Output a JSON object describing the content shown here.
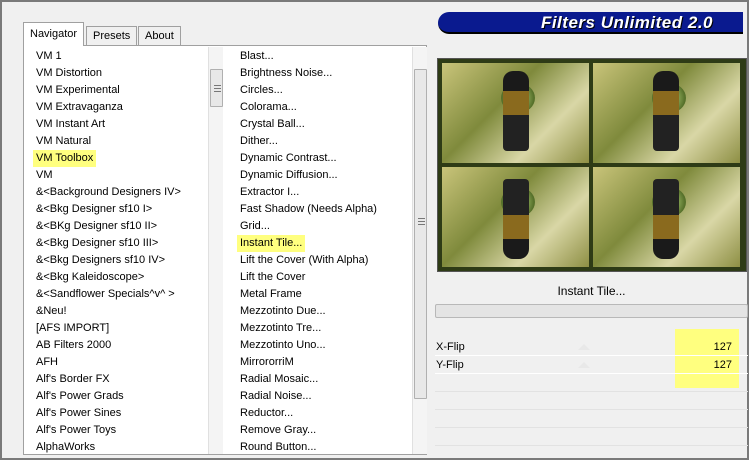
{
  "app": {
    "title": "Filters Unlimited 2.0"
  },
  "tabs": [
    {
      "label": "Navigator",
      "active": true
    },
    {
      "label": "Presets",
      "active": false
    },
    {
      "label": "About",
      "active": false
    }
  ],
  "categories": {
    "items": [
      "VM 1",
      "VM Distortion",
      "VM Experimental",
      "VM Extravaganza",
      "VM Instant Art",
      "VM Natural",
      "VM Toolbox",
      "VM",
      "&<Background Designers IV>",
      "&<Bkg Designer sf10 I>",
      "&<BKg Designer sf10 II>",
      "&<Bkg Designer sf10 III>",
      "&<Bkg Designers sf10 IV>",
      "&<Bkg Kaleidoscope>",
      "&<Sandflower Specials^v^ >",
      "&Neu!",
      "[AFS IMPORT]",
      "AB Filters 2000",
      "AFH",
      "Alf's Border FX",
      "Alf's Power Grads",
      "Alf's Power Sines",
      "Alf's Power Toys",
      "AlphaWorks"
    ],
    "selected": "VM Toolbox"
  },
  "filters": {
    "items": [
      "Blast...",
      "Brightness Noise...",
      "Circles...",
      "Colorama...",
      "Crystal Ball...",
      "Dither...",
      "Dynamic Contrast...",
      "Dynamic Diffusion...",
      "Extractor I...",
      "Fast Shadow (Needs Alpha)",
      "Grid...",
      "Instant Tile...",
      "Lift the Cover (With Alpha)",
      "Lift the Cover",
      "Metal Frame",
      "Mezzotinto Due...",
      "Mezzotinto Tre...",
      "Mezzotinto Uno...",
      "MirrororriM",
      "Radial Mosaic...",
      "Radial Noise...",
      "Reductor...",
      "Remove Gray...",
      "Round Button..."
    ],
    "selected": "Instant Tile..."
  },
  "preview": {
    "filter_name": "Instant Tile..."
  },
  "params": [
    {
      "label": "X-Flip",
      "value": "127"
    },
    {
      "label": "Y-Flip",
      "value": "127"
    }
  ],
  "colors": {
    "banner": "#0a1a8f",
    "highlight": "#ffff7f"
  }
}
